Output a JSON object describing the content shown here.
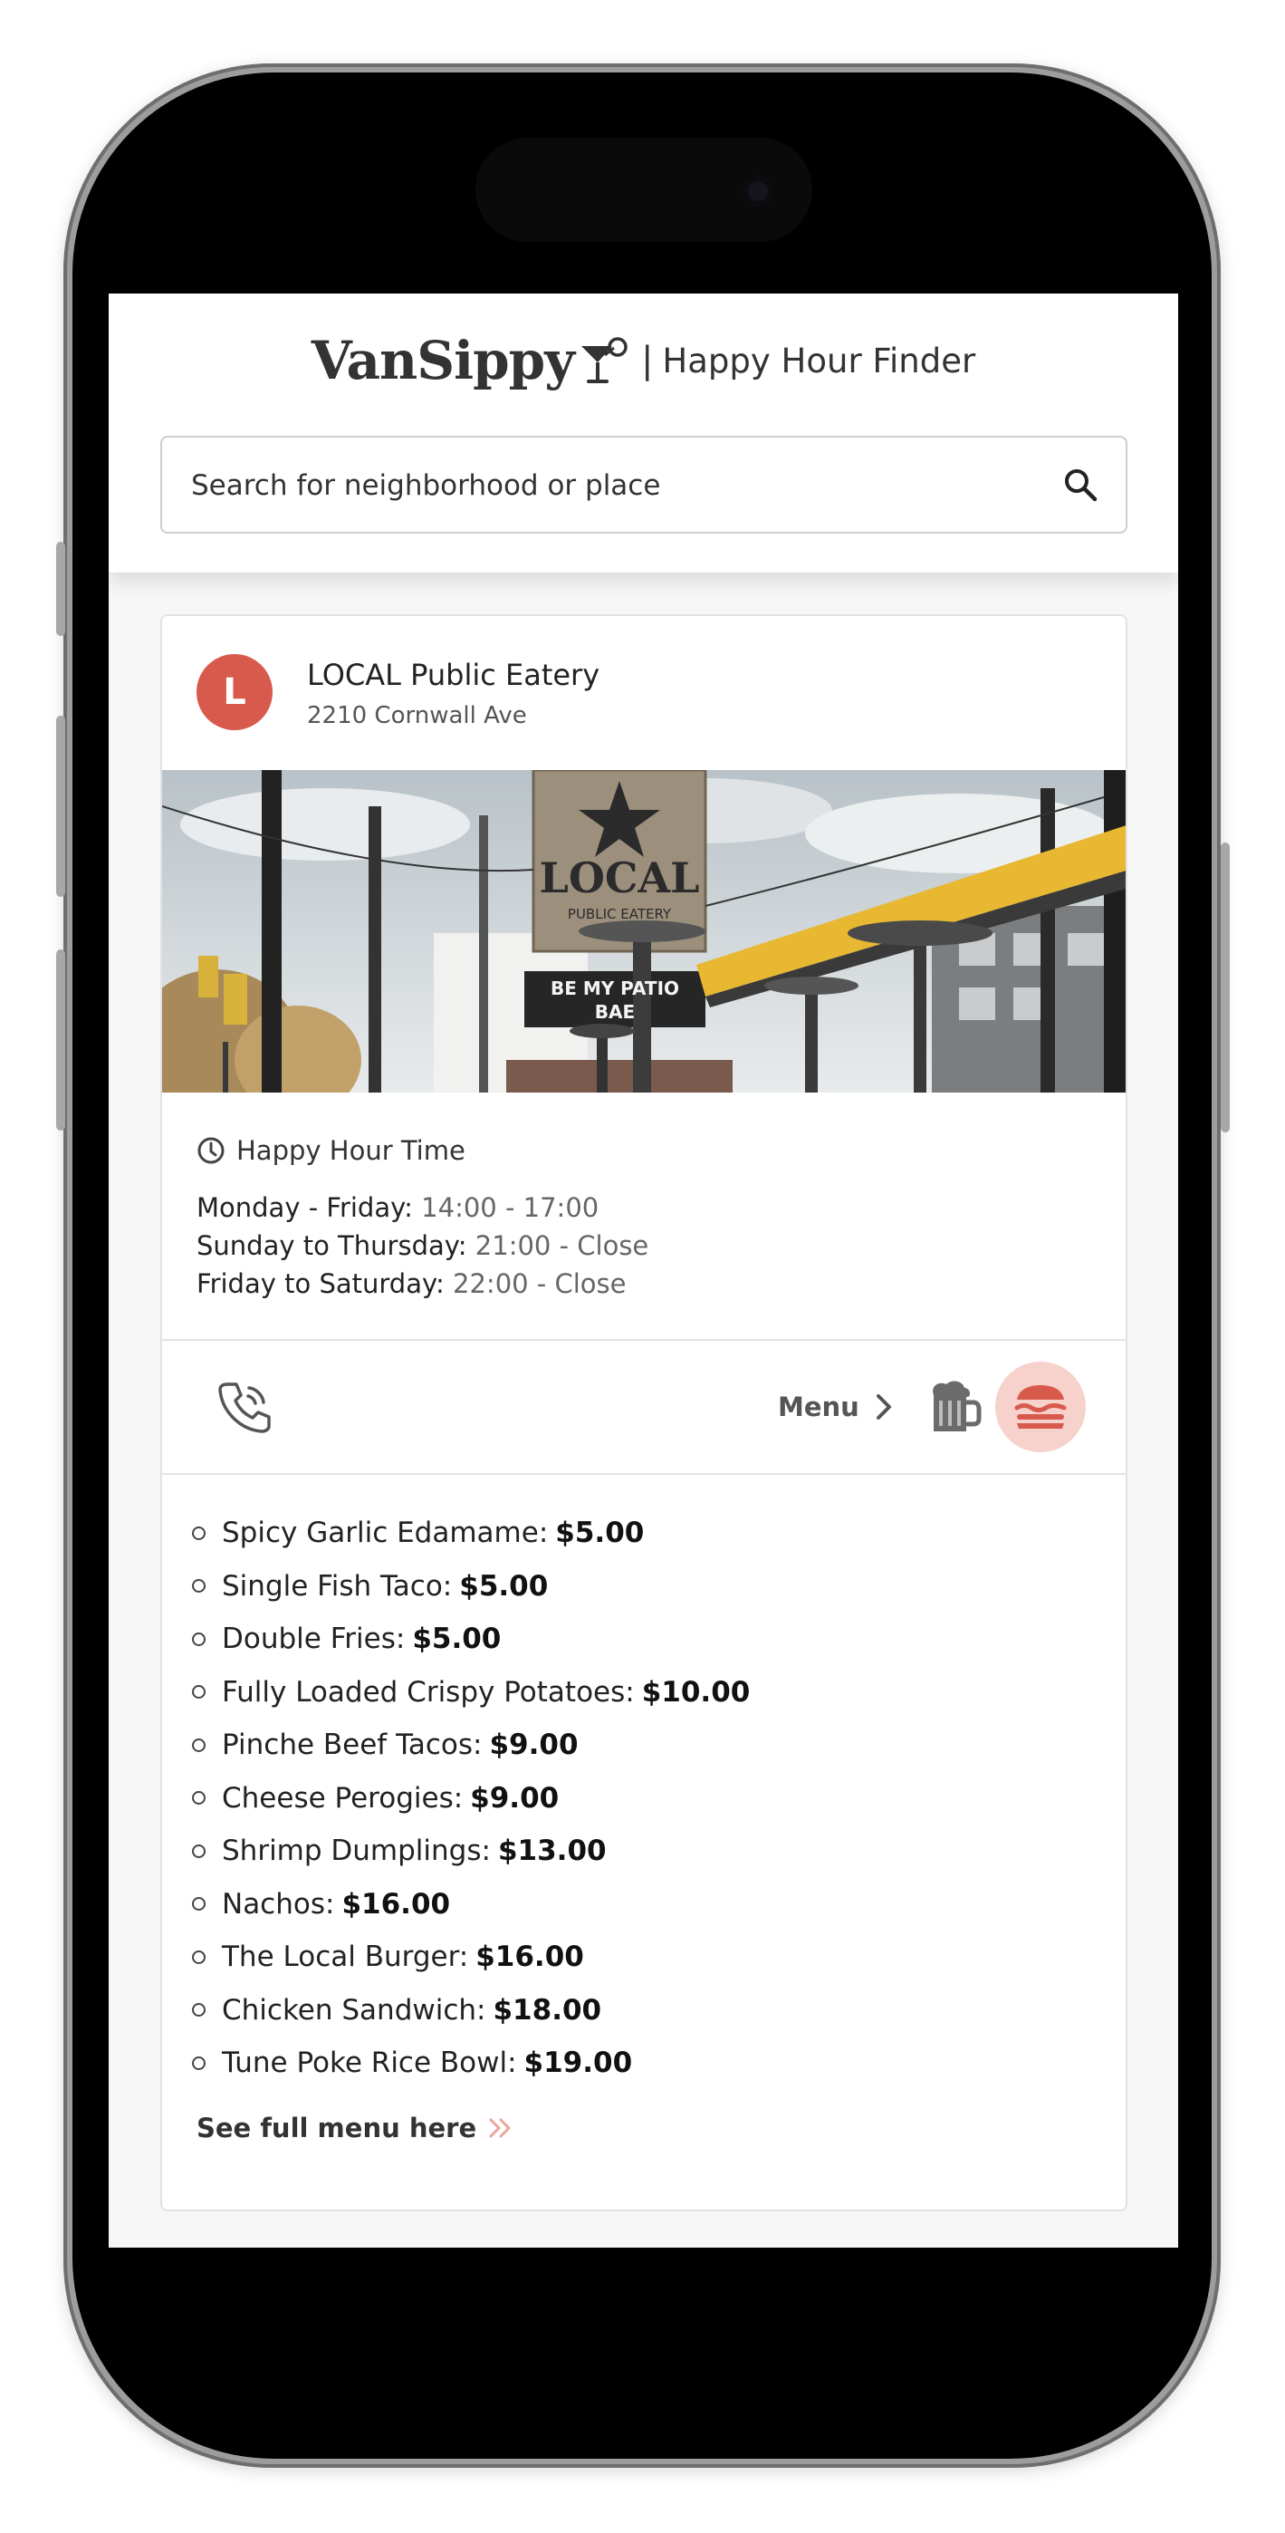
{
  "app": {
    "logo_text": "VanSippy",
    "separator": "|",
    "tagline": "Happy Hour Finder"
  },
  "search": {
    "placeholder": "Search for neighborhood or place"
  },
  "venue": {
    "avatar_letter": "L",
    "name": "LOCAL Public Eatery",
    "address": "2210 Cornwall Ave",
    "photo_sign_text": "LOCAL",
    "photo_sign_subtext": "PUBLIC EATERY",
    "photo_banner_text": "BE MY PATIO BAE",
    "photo_banner_line1": "BE MY PATIO",
    "photo_banner_line2": "BAE"
  },
  "happy_hour": {
    "title": "Happy Hour Time",
    "schedule": [
      {
        "days": "Monday - Friday:",
        "time": "14:00 - 17:00"
      },
      {
        "days": "Sunday to Thursday:",
        "time": "21:00 - Close"
      },
      {
        "days": "Friday to Saturday:",
        "time": "22:00 - Close"
      }
    ]
  },
  "actions": {
    "phone_icon": "phone-icon",
    "menu_label": "Menu",
    "drinks_icon": "beer-mug-icon",
    "food_icon": "burger-icon",
    "active_tab": "food"
  },
  "food_menu": [
    {
      "name": "Spicy Garlic Edamame:",
      "price": "$5.00"
    },
    {
      "name": "Single Fish Taco:",
      "price": "$5.00"
    },
    {
      "name": "Double Fries:",
      "price": "$5.00"
    },
    {
      "name": "Fully Loaded Crispy Potatoes:",
      "price": "$10.00"
    },
    {
      "name": "Pinche Beef Tacos:",
      "price": "$9.00"
    },
    {
      "name": "Cheese Perogies:",
      "price": "$9.00"
    },
    {
      "name": "Shrimp Dumplings:",
      "price": "$13.00"
    },
    {
      "name": "Nachos:",
      "price": "$16.00"
    },
    {
      "name": "The Local Burger:",
      "price": "$16.00"
    },
    {
      "name": "Chicken Sandwich:",
      "price": "$18.00"
    },
    {
      "name": "Tune Poke Rice Bowl:",
      "price": "$19.00"
    }
  ],
  "full_menu_link": "See full menu here",
  "colors": {
    "accent": "#d85a4c",
    "accent_light": "#f7d1cb",
    "text": "#222222",
    "muted": "#666666"
  }
}
